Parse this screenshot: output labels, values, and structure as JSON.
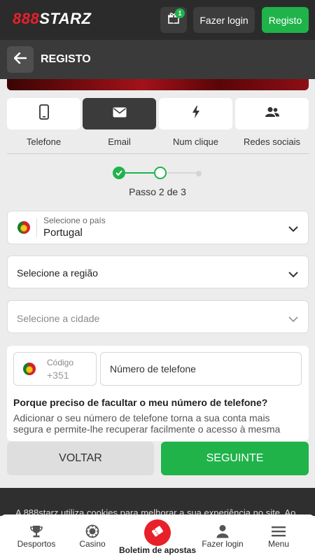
{
  "header": {
    "logo_num": "888",
    "logo_text": "STARZ",
    "gift_badge": "1",
    "login_label": "Fazer login",
    "register_label": "Registo"
  },
  "titlebar": {
    "title": "REGISTO"
  },
  "methods": [
    {
      "label": "Telefone",
      "icon": "phone-icon"
    },
    {
      "label": "Email",
      "icon": "envelope-icon"
    },
    {
      "label": "Num clique",
      "icon": "lightning-icon"
    },
    {
      "label": "Redes sociais",
      "icon": "people-icon"
    }
  ],
  "active_method": "Email",
  "stepper": {
    "current": 2,
    "total": 3,
    "text": "Passo 2 de 3"
  },
  "country_select": {
    "label": "Selecione o país",
    "value": "Portugal"
  },
  "region_select": {
    "placeholder": "Selecione a região"
  },
  "city_select": {
    "placeholder": "Selecione a cidade"
  },
  "phone": {
    "code_label": "Código",
    "code_value": "+351",
    "number_placeholder": "Número de telefone",
    "why_title": "Porque preciso de facultar o meu número de telefone?",
    "why_body": "Adicionar o seu número de telefone torna a sua conta mais segura e permite-lhe recuperar facilmente o acesso à mesma"
  },
  "actions": {
    "back_label": "VOLTAR",
    "next_label": "SEGUINTE"
  },
  "cookie_text": "A 888starz utiliza cookies para melhorar a sua experiência no site. Ao",
  "bottom_nav": [
    {
      "label": "Desportos",
      "icon": "trophy-icon"
    },
    {
      "label": "Casino",
      "icon": "chip-icon"
    },
    {
      "label": "Boletim de apostas",
      "icon": "ticket-icon"
    },
    {
      "label": "Fazer login",
      "icon": "user-icon"
    },
    {
      "label": "Menu",
      "icon": "menu-icon"
    }
  ],
  "colors": {
    "brand_green": "#1fb34a",
    "brand_red": "#e8202a",
    "header_bg": "#2b2b2b"
  }
}
